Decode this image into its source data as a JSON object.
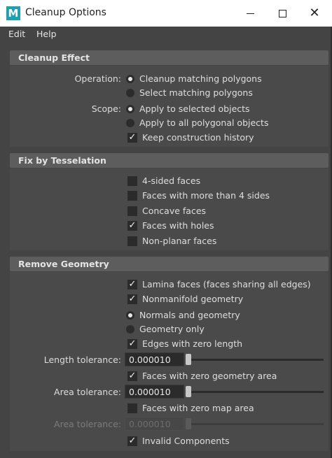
{
  "window": {
    "title": "Cleanup Options",
    "icon_letter": "M",
    "icon_color": "#1d9fb4",
    "minimize_icon": "minimize-icon",
    "maximize_icon": "maximize-icon",
    "close_icon": "close-icon",
    "close_glyph": "✕"
  },
  "menu": {
    "edit": "Edit",
    "help": "Help"
  },
  "cleanup_effect": {
    "header": "Cleanup Effect",
    "operation_label": "Operation:",
    "operation_options": [
      "Cleanup matching polygons",
      "Select matching polygons"
    ],
    "operation_selected": 0,
    "scope_label": "Scope:",
    "scope_options": [
      "Apply to selected objects",
      "Apply to all polygonal objects"
    ],
    "scope_selected": 0,
    "keep_history": {
      "label": "Keep construction history",
      "checked": true
    }
  },
  "fix_by_tesselation": {
    "header": "Fix by Tesselation",
    "items": [
      {
        "label": "4-sided faces",
        "checked": false
      },
      {
        "label": "Faces with more than 4 sides",
        "checked": false
      },
      {
        "label": "Concave faces",
        "checked": false
      },
      {
        "label": "Faces with holes",
        "checked": true
      },
      {
        "label": "Non-planar faces",
        "checked": false
      }
    ]
  },
  "remove_geometry": {
    "header": "Remove Geometry",
    "lamina": {
      "label": "Lamina faces (faces sharing all edges)",
      "checked": true
    },
    "nonmanifold": {
      "label": "Nonmanifold geometry",
      "checked": true
    },
    "nonmanifold_options": [
      "Normals and geometry",
      "Geometry only"
    ],
    "nonmanifold_selected": 0,
    "zero_length_edges": {
      "label": "Edges with zero length",
      "checked": true
    },
    "length_tolerance": {
      "label": "Length tolerance:",
      "value": "0.000010",
      "slider": 0.0
    },
    "zero_area_faces": {
      "label": "Faces with zero geometry area",
      "checked": true
    },
    "area_tolerance": {
      "label": "Area tolerance:",
      "value": "0.000010",
      "slider": 0.0
    },
    "zero_map_area": {
      "label": "Faces with zero map area",
      "checked": false
    },
    "map_area_tolerance": {
      "label": "Area tolerance:",
      "value": "0.000010",
      "slider": 0.0,
      "enabled": false
    },
    "invalid_components": {
      "label": "Invalid Components",
      "checked": true
    }
  },
  "check_glyph": "✓"
}
